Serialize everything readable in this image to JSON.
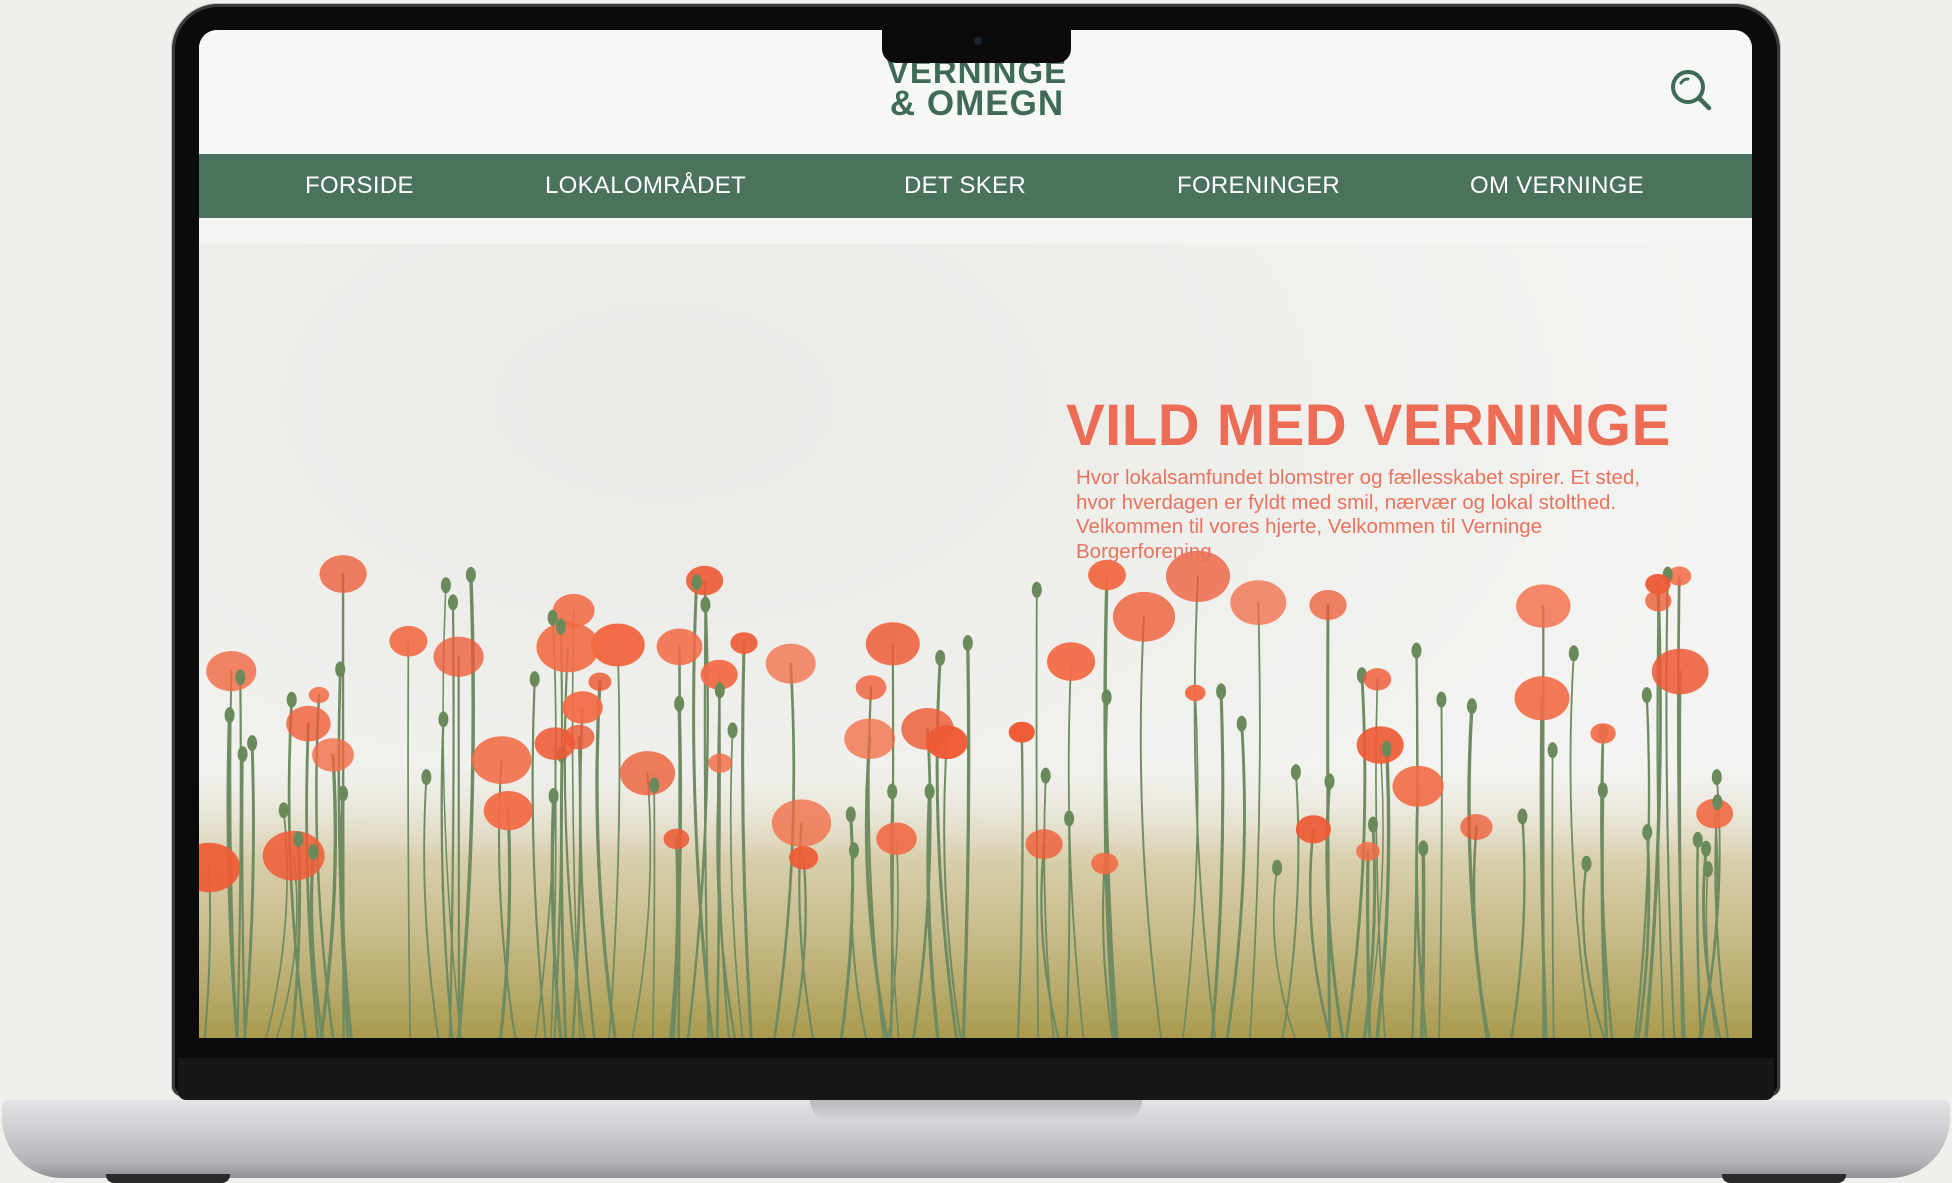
{
  "logo": {
    "line1": "VERNINGE",
    "line2": "& OMEGN"
  },
  "nav": {
    "items": [
      {
        "label": "FORSIDE"
      },
      {
        "label": "LOKALOMRÅDET"
      },
      {
        "label": "DET SKER"
      },
      {
        "label": "FORENINGER"
      },
      {
        "label": "OM VERNINGE"
      }
    ]
  },
  "hero": {
    "title": "VILD MED VERNINGE",
    "text": "Hvor lokalsamfundet blomstrer og fællesskabet spirer. Et sted, hvor hverdagen er fyldt med smil, nærvær og lokal stolthed. Velkommen til vores hjerte, Velkommen til Verninge Borgerforening"
  },
  "icons": {
    "search": "search-icon"
  },
  "colors": {
    "brand_green": "#4b725d",
    "logo_green": "#3f6a55",
    "accent_coral": "#ec6c55",
    "page_background": "#f6f8f5"
  }
}
